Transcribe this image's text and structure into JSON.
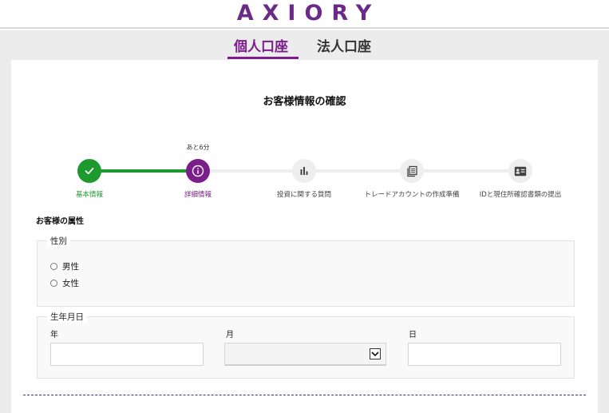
{
  "header": {
    "logo": "AXIORY"
  },
  "tabs": [
    {
      "label": "個人口座",
      "active": true
    },
    {
      "label": "法人口座",
      "active": false
    }
  ],
  "page_title": "お客様情報の確認",
  "progress": {
    "remaining_text": "あと6分",
    "steps": [
      {
        "label": "基本情報",
        "state": "complete",
        "icon": "check-icon"
      },
      {
        "label": "詳細情報",
        "state": "current",
        "icon": "info-icon"
      },
      {
        "label": "投資に関する質問",
        "state": "pending",
        "icon": "bar-chart-icon"
      },
      {
        "label": "トレードアカウントの作成準備",
        "state": "pending",
        "icon": "document-stack-icon"
      },
      {
        "label": "IDと現住所確認書類の提出",
        "state": "pending",
        "icon": "id-card-icon"
      }
    ]
  },
  "attributes": {
    "section_title": "お客様の属性",
    "gender": {
      "legend": "性別",
      "options": [
        "男性",
        "女性"
      ]
    },
    "dob": {
      "legend": "生年月日",
      "year_label": "年",
      "month_label": "月",
      "day_label": "日",
      "year_value": "",
      "month_value": "",
      "day_value": ""
    }
  },
  "colors": {
    "brand": "#7b1d8a",
    "complete": "#1d9a2e"
  }
}
